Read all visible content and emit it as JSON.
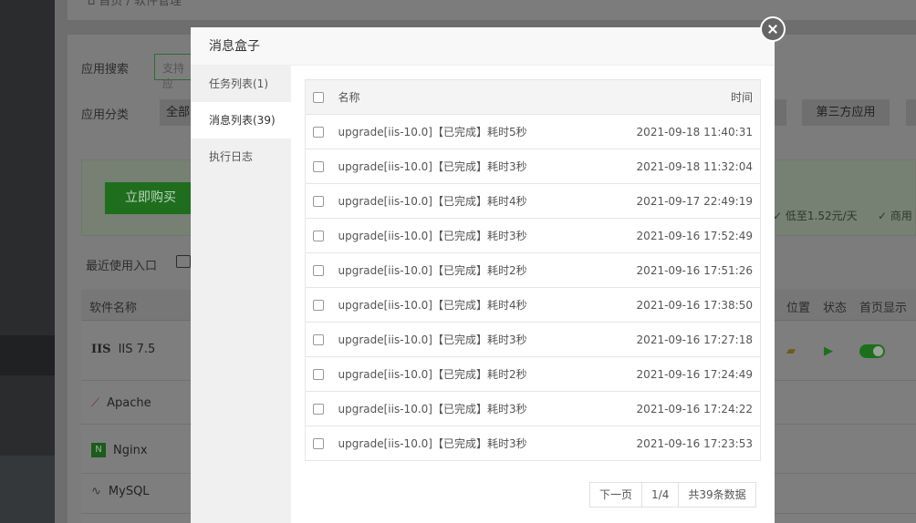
{
  "background": {
    "breadcrumb": "首页 / 软件管理",
    "search_label": "应用搜索",
    "search_placeholder": "支持应",
    "category_label": "应用分类",
    "category_all": "全部",
    "category_third": "第三方应用",
    "buy_button": "立即购买",
    "promo_price": "✓ 低至1.52元/天",
    "promo_commercial": "✓ 商用",
    "recent_label": "最近使用入口",
    "table_header_name": "软件名称",
    "table_header_location": "位置",
    "table_header_status": "状态",
    "table_header_home": "首页显示",
    "software": [
      {
        "icon": "IIS",
        "name": "IIS 7.5"
      },
      {
        "icon": "feather",
        "name": "Apache"
      },
      {
        "icon": "N",
        "name": "Nginx"
      },
      {
        "icon": "dolphin",
        "name": "MySQL"
      }
    ]
  },
  "modal": {
    "title": "消息盒子",
    "tabs": [
      {
        "label": "任务列表(1)"
      },
      {
        "label": "消息列表(39)"
      },
      {
        "label": "执行日志"
      }
    ],
    "table": {
      "header_name": "名称",
      "header_time": "时间",
      "rows": [
        {
          "name": "upgrade[iis-10.0]【已完成】耗时5秒",
          "time": "2021-09-18 11:40:31"
        },
        {
          "name": "upgrade[iis-10.0]【已完成】耗时3秒",
          "time": "2021-09-18 11:32:04"
        },
        {
          "name": "upgrade[iis-10.0]【已完成】耗时4秒",
          "time": "2021-09-17 22:49:19"
        },
        {
          "name": "upgrade[iis-10.0]【已完成】耗时3秒",
          "time": "2021-09-16 17:52:49"
        },
        {
          "name": "upgrade[iis-10.0]【已完成】耗时2秒",
          "time": "2021-09-16 17:51:26"
        },
        {
          "name": "upgrade[iis-10.0]【已完成】耗时4秒",
          "time": "2021-09-16 17:38:50"
        },
        {
          "name": "upgrade[iis-10.0]【已完成】耗时3秒",
          "time": "2021-09-16 17:27:18"
        },
        {
          "name": "upgrade[iis-10.0]【已完成】耗时2秒",
          "time": "2021-09-16 17:24:49"
        },
        {
          "name": "upgrade[iis-10.0]【已完成】耗时3秒",
          "time": "2021-09-16 17:24:22"
        },
        {
          "name": "upgrade[iis-10.0]【已完成】耗时3秒",
          "time": "2021-09-16 17:23:53"
        }
      ]
    },
    "pager": {
      "next": "下一页",
      "page": "1/4",
      "total": "共39条数据"
    }
  },
  "colors": {
    "accent_green": "#20a53a"
  }
}
